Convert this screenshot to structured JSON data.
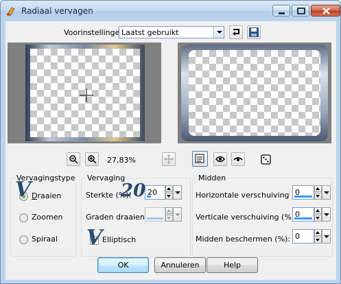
{
  "window": {
    "title": "Radiaal vervagen"
  },
  "presets": {
    "label": "Voorinstellingen:",
    "value": "Laatst gebruikt"
  },
  "zoom": {
    "level": "27,83%"
  },
  "blur_type": {
    "title": "Vervagingstype",
    "options": [
      {
        "label": "Draaien",
        "selected": true
      },
      {
        "label": "Zoomen",
        "selected": false
      },
      {
        "label": "Spiraal",
        "selected": false
      }
    ]
  },
  "blur": {
    "title": "Vervaging",
    "strength_label": "Sterkte (%):",
    "strength_value": "20",
    "rotate_label": "Graden draaien:",
    "rotate_value": "",
    "elliptical_label": "Elliptisch",
    "elliptical_checked": true
  },
  "center": {
    "title": "Midden",
    "h_offset_label": "Horizontale verschuiving (%):",
    "h_offset_value": "0",
    "v_offset_label": "Verticale verschuiving (%):",
    "v_offset_value": "0",
    "protect_label": "Midden beschermen (%):",
    "protect_value": "0"
  },
  "annotations": {
    "marker_1": "V",
    "marker_2": "20",
    "marker_3": "V"
  },
  "buttons": {
    "ok": "OK",
    "cancel": "Annuleren",
    "help": "Help"
  },
  "colors": {
    "accent": "#3399ff",
    "stamp": "#2b4a6f",
    "close_button": "#c4472b"
  }
}
